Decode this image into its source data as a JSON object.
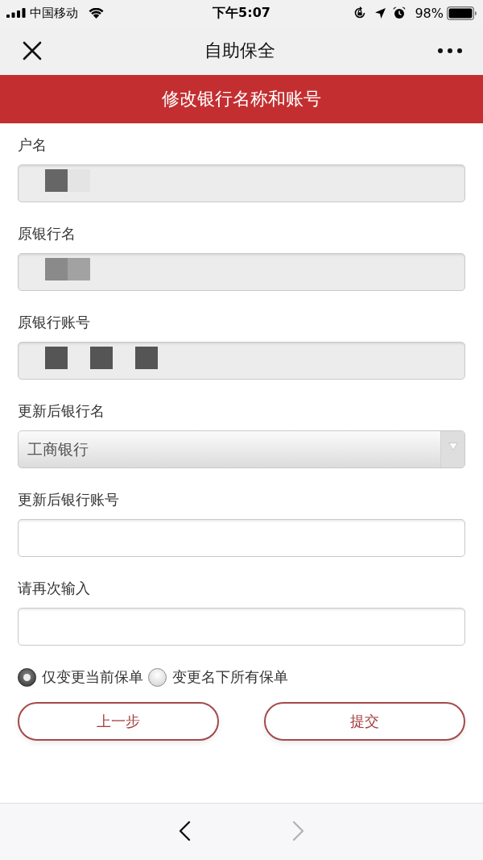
{
  "status_bar": {
    "carrier": "中国移动",
    "time": "下午5:07",
    "battery": "98%"
  },
  "nav_bar": {
    "title": "自助保全"
  },
  "banner": {
    "title": "修改银行名称和账号"
  },
  "fields": [
    {
      "kind": "redacted",
      "label": "户名",
      "mosaic": [
        {
          "kind": "tile",
          "color": "#666666"
        },
        {
          "kind": "tile",
          "color": "#e4e4e4"
        }
      ]
    },
    {
      "kind": "redacted",
      "label": "原银行名",
      "mosaic": [
        {
          "kind": "tile",
          "color": "#8a8a8a"
        },
        {
          "kind": "tile",
          "color": "#a2a2a2"
        }
      ]
    },
    {
      "kind": "redacted",
      "label": "原银行账号",
      "mosaic": [
        {
          "kind": "tile",
          "color": "#555555"
        },
        {
          "kind": "gap"
        },
        {
          "kind": "tile",
          "color": "#555555"
        },
        {
          "kind": "gap"
        },
        {
          "kind": "tile",
          "color": "#555555"
        }
      ]
    },
    {
      "kind": "select",
      "label": "更新后银行名",
      "value": "工商银行"
    },
    {
      "kind": "input",
      "label": "更新后银行账号"
    },
    {
      "kind": "input",
      "label": "请再次输入"
    }
  ],
  "scope_options": [
    {
      "label": "仅变更当前保单",
      "selected": true
    },
    {
      "label": "变更名下所有保单",
      "selected": false
    }
  ],
  "buttons": [
    {
      "label": "上一步"
    },
    {
      "label": "提交"
    }
  ],
  "toolbar": [
    {
      "kind": "back",
      "disabled": false
    },
    {
      "kind": "forward",
      "disabled": true
    }
  ]
}
